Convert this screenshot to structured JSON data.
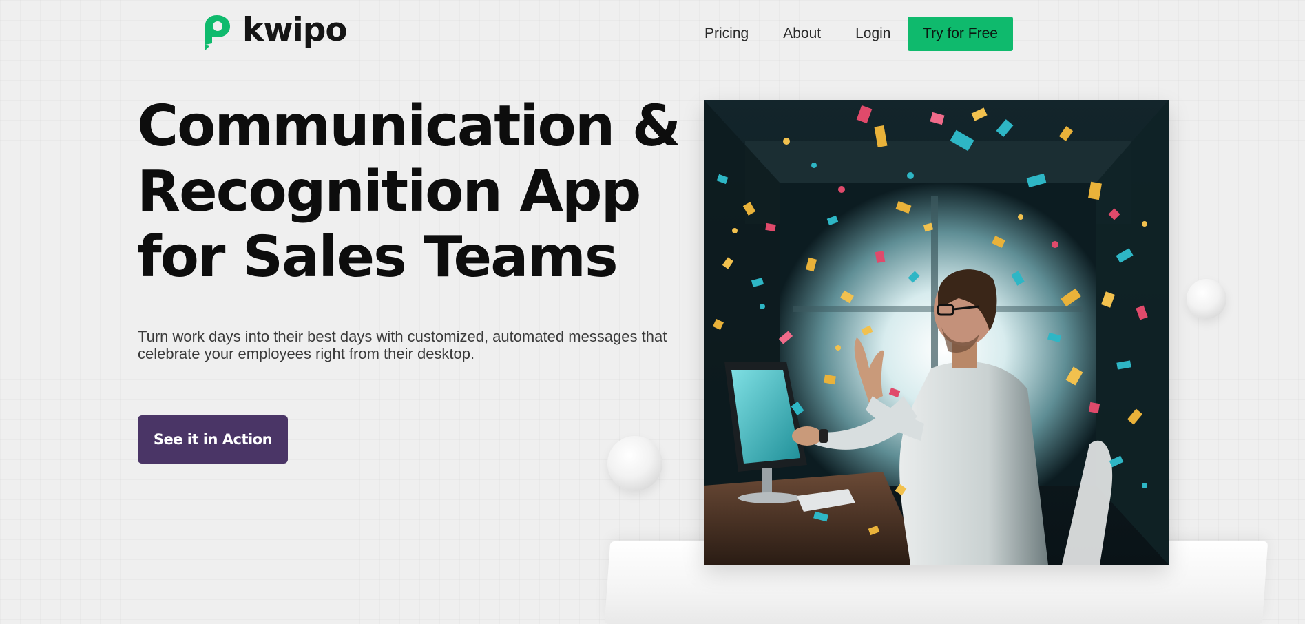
{
  "brand": {
    "name": "kwipo",
    "accent_color": "#0fba6d"
  },
  "nav": {
    "links": [
      {
        "label": "Pricing"
      },
      {
        "label": "About"
      },
      {
        "label": "Login"
      }
    ],
    "cta_label": "Try for Free"
  },
  "hero": {
    "title_lines": [
      "Communication &",
      "Recognition App",
      "for Sales Teams"
    ],
    "subtitle": "Turn work days into their best days with customized, automated messages that celebrate your employees right from their desktop.",
    "cta_label": "See it in Action",
    "cta_color": "#4a3566",
    "image_icon": "photo-man-celebrating-confetti"
  }
}
